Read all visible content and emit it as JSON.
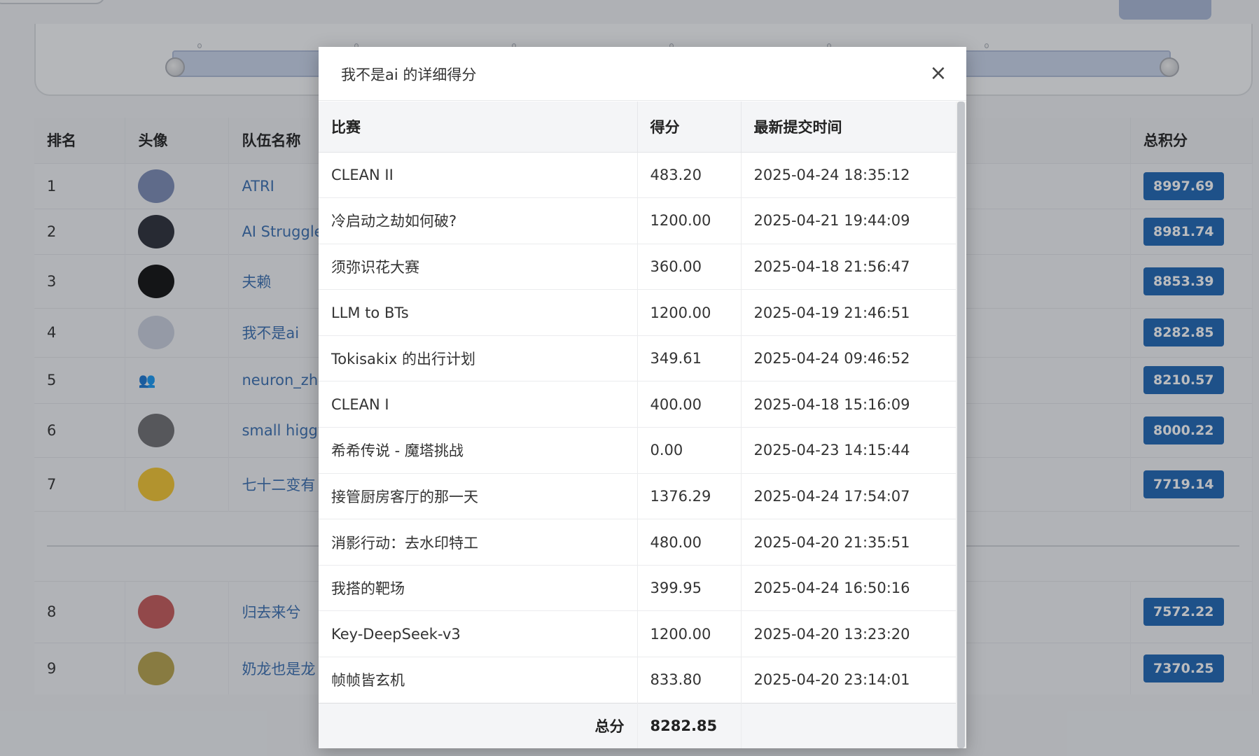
{
  "leaderboard": {
    "headers": {
      "rank": "排名",
      "avatar": "头像",
      "team": "队伍名称",
      "total": "总积分"
    },
    "rows": [
      {
        "rank": "1",
        "team": "ATRI",
        "total": "8997.69",
        "avatar_color": "#7b8bb5"
      },
      {
        "rank": "2",
        "team": "AI Struggler",
        "total": "8981.74",
        "avatar_color": "#2b2e38"
      },
      {
        "rank": "3",
        "team": "夫赖",
        "total": "8853.39",
        "avatar_color": "#111111"
      },
      {
        "rank": "4",
        "team": "我不是ai",
        "total": "8282.85",
        "avatar_color": "#c9cfdd"
      },
      {
        "rank": "5",
        "team": "neuron_zhix",
        "total": "8210.57",
        "avatar_icon": "users-icon"
      },
      {
        "rank": "6",
        "team": "small higgy",
        "total": "8000.22",
        "avatar_color": "#6f6f72"
      },
      {
        "rank": "7",
        "team": "七十二变有",
        "total": "7719.14",
        "avatar_color": "#f3c531"
      }
    ],
    "rows_after_divider": [
      {
        "rank": "8",
        "team": "归去来兮",
        "total": "7572.22",
        "avatar_color": "#c55a5a"
      },
      {
        "rank": "9",
        "team": "奶龙也是龙",
        "total": "7370.25",
        "avatar_color": "#b6a24c"
      }
    ]
  },
  "modal": {
    "title": "我不是ai 的详细得分",
    "close_label": "×",
    "columns": {
      "contest": "比赛",
      "score": "得分",
      "latest_submit": "最新提交时间"
    },
    "rows": [
      {
        "contest": "CLEAN II",
        "score": "483.20",
        "time": "2025-04-24 18:35:12"
      },
      {
        "contest": "冷启动之劫如何破?",
        "score": "1200.00",
        "time": "2025-04-21 19:44:09"
      },
      {
        "contest": "须弥识花大赛",
        "score": "360.00",
        "time": "2025-04-18 21:56:47"
      },
      {
        "contest": "LLM to BTs",
        "score": "1200.00",
        "time": "2025-04-19 21:46:51"
      },
      {
        "contest": "Tokisakix 的出行计划",
        "score": "349.61",
        "time": "2025-04-24 09:46:52"
      },
      {
        "contest": "CLEAN I",
        "score": "400.00",
        "time": "2025-04-18 15:16:09"
      },
      {
        "contest": "希希传说 - 魔塔挑战",
        "score": "0.00",
        "time": "2025-04-23 14:15:44"
      },
      {
        "contest": "接管厨房客厅的那一天",
        "score": "1376.29",
        "time": "2025-04-24 17:54:07"
      },
      {
        "contest": "消影行动：去水印特工",
        "score": "480.00",
        "time": "2025-04-20 21:35:51"
      },
      {
        "contest": "我搭的靶场",
        "score": "399.95",
        "time": "2025-04-24 16:50:16"
      },
      {
        "contest": "Key-DeepSeek-v3",
        "score": "1200.00",
        "time": "2025-04-20 13:23:20"
      },
      {
        "contest": "帧帧皆玄机",
        "score": "833.80",
        "time": "2025-04-20 23:14:01"
      }
    ],
    "total_label": "总分",
    "total_value": "8282.85"
  }
}
